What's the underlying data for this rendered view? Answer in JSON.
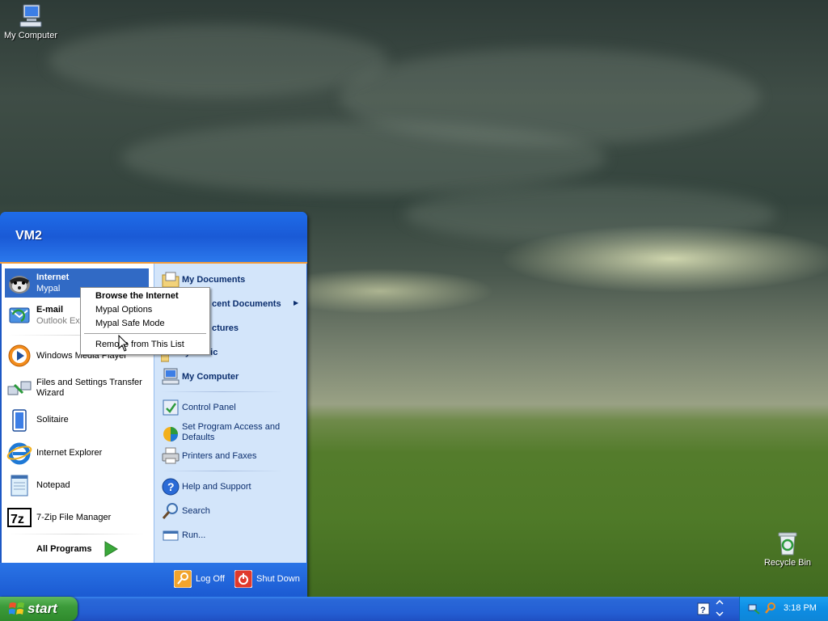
{
  "desktop": {
    "icons": [
      {
        "label": "My Computer",
        "icon": "my-computer-icon"
      },
      {
        "label": "Recycle Bin",
        "icon": "recycle-bin-icon"
      }
    ]
  },
  "start_menu": {
    "user": "VM2",
    "pinned": [
      {
        "title": "Internet",
        "subtitle": "Mypal",
        "icon": "mypal-browser-icon"
      },
      {
        "title": "E-mail",
        "subtitle": "Outlook Exp",
        "icon": "email-icon"
      }
    ],
    "recent": [
      {
        "label": "Windows Media Player",
        "icon": "media-player-icon"
      },
      {
        "label": "Files and Settings Transfer",
        "label2": "Wizard",
        "icon": "transfer-wizard-icon"
      },
      {
        "label": "Solitaire",
        "icon": "solitaire-icon"
      },
      {
        "label": "Internet Explorer",
        "icon": "internet-explorer-icon"
      },
      {
        "label": "Notepad",
        "icon": "notepad-icon"
      },
      {
        "label": "7-Zip File Manager",
        "icon": "7zip-icon"
      }
    ],
    "all_programs": "All Programs",
    "right": {
      "my_documents": "My Documents",
      "recent_documents": "cent Documents",
      "my_pictures": "ctures",
      "my_music": "y Music",
      "my_computer": "My Computer",
      "control_panel": "Control Panel",
      "set_program_access_1": "Set Program Access and",
      "set_program_access_2": "Defaults",
      "printers": "Printers and Faxes",
      "help": "Help and Support",
      "search": "Search",
      "run": "Run..."
    },
    "log_off": "Log Off",
    "shut_down": "Shut Down"
  },
  "context_menu": {
    "items": [
      "Browse the Internet",
      "Mypal Options",
      "Mypal Safe Mode",
      "Remove from This List"
    ]
  },
  "taskbar": {
    "start_label": "start",
    "clock": "3:18 PM"
  },
  "colors": {
    "taskbar_blue": "#245ed3",
    "start_green": "#3c9b3a",
    "highlight": "#316ac5",
    "accent_orange": "#f29c3c"
  }
}
